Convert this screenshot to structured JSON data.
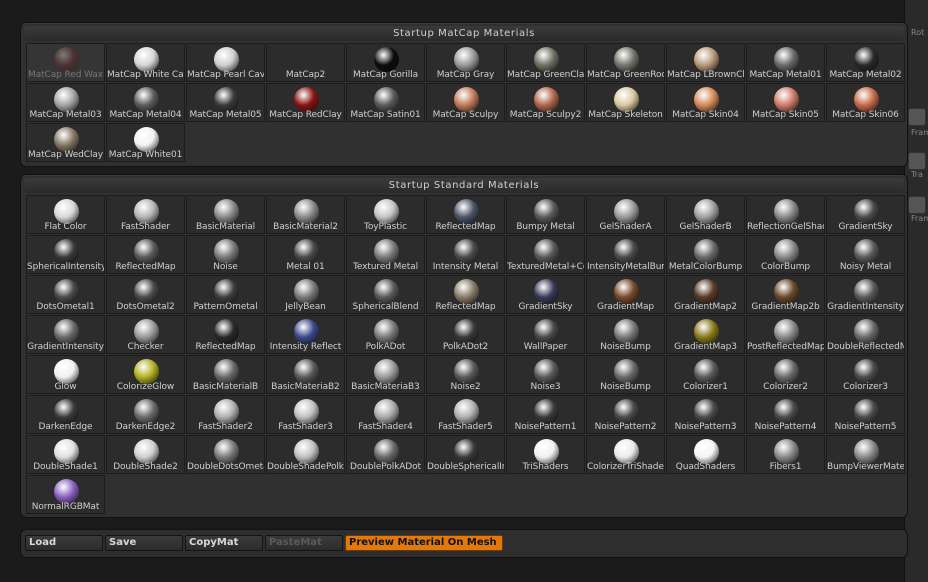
{
  "side_labels": [
    "Rot",
    "Frame",
    "Tra",
    "Frame"
  ],
  "matcap_panel": {
    "title": "Startup MatCap Materials",
    "items": [
      {
        "label": "MatCap Red Wax",
        "color": "#7a2d2a",
        "dim": true
      },
      {
        "label": "MatCap White Cavity",
        "color": "#d6d6d6"
      },
      {
        "label": "MatCap Pearl Cavity",
        "color": "#cfcfcf"
      },
      {
        "label": "MatCap2",
        "color": "",
        "dim": false
      },
      {
        "label": "MatCap Gorilla",
        "color": "#0c0c0c"
      },
      {
        "label": "MatCap Gray",
        "color": "#9a9a9a"
      },
      {
        "label": "MatCap GreenClay",
        "color": "#6d7262"
      },
      {
        "label": "MatCap GreenRock",
        "color": "#74776b"
      },
      {
        "label": "MatCap LBrownClay",
        "color": "#b89a78"
      },
      {
        "label": "MatCap Metal01",
        "color": "#6a6a6a"
      },
      {
        "label": "MatCap Metal02",
        "color": "#2a2a2a"
      },
      {
        "label": "MatCap Metal03",
        "color": "#a5a5a5"
      },
      {
        "label": "MatCap Metal04",
        "color": "#5c5c5c"
      },
      {
        "label": "MatCap Metal05",
        "color": "#3a3a3a"
      },
      {
        "label": "MatCap RedClay",
        "color": "#8a1414"
      },
      {
        "label": "MatCap Satin01",
        "color": "#5a5a5a"
      },
      {
        "label": "MatCap Sculpy",
        "color": "#c07a5a"
      },
      {
        "label": "MatCap Sculpy2",
        "color": "#b0684a"
      },
      {
        "label": "MatCap Skeleton",
        "color": "#d8c8a0"
      },
      {
        "label": "MatCap Skin04",
        "color": "#d68a5a"
      },
      {
        "label": "MatCap Skin05",
        "color": "#d07a6a"
      },
      {
        "label": "MatCap Skin06",
        "color": "#c86a4a"
      },
      {
        "label": "MatCap WedClay",
        "color": "#847866"
      },
      {
        "label": "MatCap White01",
        "color": "#f2f2f2"
      }
    ]
  },
  "standard_panel": {
    "title": "Startup Standard Materials",
    "items": [
      {
        "label": "Flat Color",
        "color": "#d8d8d8"
      },
      {
        "label": "FastShader",
        "color": "#b5b5b5"
      },
      {
        "label": "BasicMaterial",
        "color": "#8a8a8a"
      },
      {
        "label": "BasicMaterial2",
        "color": "#8a8a8a"
      },
      {
        "label": "ToyPlastic",
        "color": "#c4c4c4"
      },
      {
        "label": "ReflectedMap",
        "color": "#4a5566"
      },
      {
        "label": "Bumpy Metal",
        "color": "#5a5a5a"
      },
      {
        "label": "GelShaderA",
        "color": "#9a9a9a"
      },
      {
        "label": "GelShaderB",
        "color": "#a0a0a0"
      },
      {
        "label": "ReflectionGelShader",
        "color": "#8a8a8a"
      },
      {
        "label": "GradientSky",
        "color": "#4a4a4a"
      },
      {
        "label": "SphericalIntensity",
        "color": "#3a3a3a"
      },
      {
        "label": "ReflectedMap",
        "color": "#5a5a5a"
      },
      {
        "label": "Noise",
        "color": "#7a7a7a"
      },
      {
        "label": "Metal 01",
        "color": "#4a4a4a"
      },
      {
        "label": "Textured Metal",
        "color": "#7a7a7a"
      },
      {
        "label": "Intensity Metal",
        "color": "#4a4a4a"
      },
      {
        "label": "TexturedMetal+Color",
        "color": "#5a5a5a"
      },
      {
        "label": "IntensityMetalBump",
        "color": "#4a4a4a"
      },
      {
        "label": "MetalColorBump",
        "color": "#6a6a6a"
      },
      {
        "label": "ColorBump",
        "color": "#8a8a8a"
      },
      {
        "label": "Noisy Metal",
        "color": "#5a5a5a"
      },
      {
        "label": "DotsOmetal1",
        "color": "#4a4a4a"
      },
      {
        "label": "DotsOmetal2",
        "color": "#4a4a4a"
      },
      {
        "label": "PatternOmetal",
        "color": "#3e3e3e"
      },
      {
        "label": "JellyBean",
        "color": "#7a7a7a"
      },
      {
        "label": "SphericalBlend",
        "color": "#5a5a5a"
      },
      {
        "label": "ReflectedMap",
        "color": "#8a7a6a"
      },
      {
        "label": "GradientSky",
        "color": "#3a3a5a"
      },
      {
        "label": "GradientMap",
        "color": "#7a4a2a"
      },
      {
        "label": "GradientMap2",
        "color": "#5a3a2a"
      },
      {
        "label": "GradientMap2b",
        "color": "#6a4a2a"
      },
      {
        "label": "GradientIntensity",
        "color": "#5a5a5a"
      },
      {
        "label": "GradientIntensity",
        "color": "#6a6a6a"
      },
      {
        "label": "Checker",
        "color": "#9a9a9a"
      },
      {
        "label": "ReflectedMap",
        "color": "#2a2a2a"
      },
      {
        "label": "Intensity Reflect",
        "color": "#3a4a8a"
      },
      {
        "label": "PolkADot",
        "color": "#7a7a7a"
      },
      {
        "label": "PolkADot2",
        "color": "#3a3a3a"
      },
      {
        "label": "WallPaper",
        "color": "#4a4a4a"
      },
      {
        "label": "NoiseBump",
        "color": "#7a7a7a"
      },
      {
        "label": "GradientMap3",
        "color": "#8a7a1a"
      },
      {
        "label": "PostReflectedMap",
        "color": "#8a8a8a"
      },
      {
        "label": "DoubleReflectedMap",
        "color": "#6a6a6a"
      },
      {
        "label": "Glow",
        "color": "#f0f0f0"
      },
      {
        "label": "ColorizeGlow",
        "color": "#b0b020"
      },
      {
        "label": "BasicMaterialB",
        "color": "#6a6a6a"
      },
      {
        "label": "BasicMateriaB2",
        "color": "#5a5a5a"
      },
      {
        "label": "BasicMateriaB3",
        "color": "#9a9a9a"
      },
      {
        "label": "Noise2",
        "color": "#5a5a5a"
      },
      {
        "label": "Noise3",
        "color": "#5a5a5a"
      },
      {
        "label": "NoiseBump",
        "color": "#6a6a6a"
      },
      {
        "label": "Colorizer1",
        "color": "#5a5a5a"
      },
      {
        "label": "Colorizer2",
        "color": "#6a6a6a"
      },
      {
        "label": "Colorizer3",
        "color": "#4a4a4a"
      },
      {
        "label": "DarkenEdge",
        "color": "#3a3a3a"
      },
      {
        "label": "DarkenEdge2",
        "color": "#6a6a6a"
      },
      {
        "label": "FastShader2",
        "color": "#b0b0b0"
      },
      {
        "label": "FastShader3",
        "color": "#c0c0c0"
      },
      {
        "label": "FastShader4",
        "color": "#aaaaaa"
      },
      {
        "label": "FastShader5",
        "color": "#b0b0b0"
      },
      {
        "label": "NoisePattern1",
        "color": "#3a3a3a"
      },
      {
        "label": "NoisePattern2",
        "color": "#4a4a4a"
      },
      {
        "label": "NoisePattern3",
        "color": "#4a4a4a"
      },
      {
        "label": "NoisePattern4",
        "color": "#4a4a4a"
      },
      {
        "label": "NoisePattern5",
        "color": "#4a4a4a"
      },
      {
        "label": "DoubleShade1",
        "color": "#e0e0e0"
      },
      {
        "label": "DoubleShade2",
        "color": "#d0d0d0"
      },
      {
        "label": "DoubleDotsOmetal",
        "color": "#7a7a7a"
      },
      {
        "label": "DoubleShadePolkADot",
        "color": "#c0c0c0"
      },
      {
        "label": "DoublePolkADot",
        "color": "#6a6a6a"
      },
      {
        "label": "DoubleSphericalIntensity",
        "color": "#3a3a3a"
      },
      {
        "label": "TriShaders",
        "color": "#f0f0f0"
      },
      {
        "label": "ColorizerTriShader",
        "color": "#eaeaea"
      },
      {
        "label": "QuadShaders",
        "color": "#f4f4f4"
      },
      {
        "label": "Fibers1",
        "color": "#8a8a8a"
      },
      {
        "label": "BumpViewerMaterial",
        "color": "#8a8a8a"
      },
      {
        "label": "NormalRGBMat",
        "color": "#8a60c0"
      }
    ]
  },
  "bottom_bar": {
    "load": "Load",
    "save": "Save",
    "copy": "CopyMat",
    "paste": "PasteMat",
    "preview": "Preview Material On Mesh"
  },
  "colors": {
    "accent": "#e4780b",
    "panel": "#303030",
    "tile": "#2c2c2c"
  }
}
